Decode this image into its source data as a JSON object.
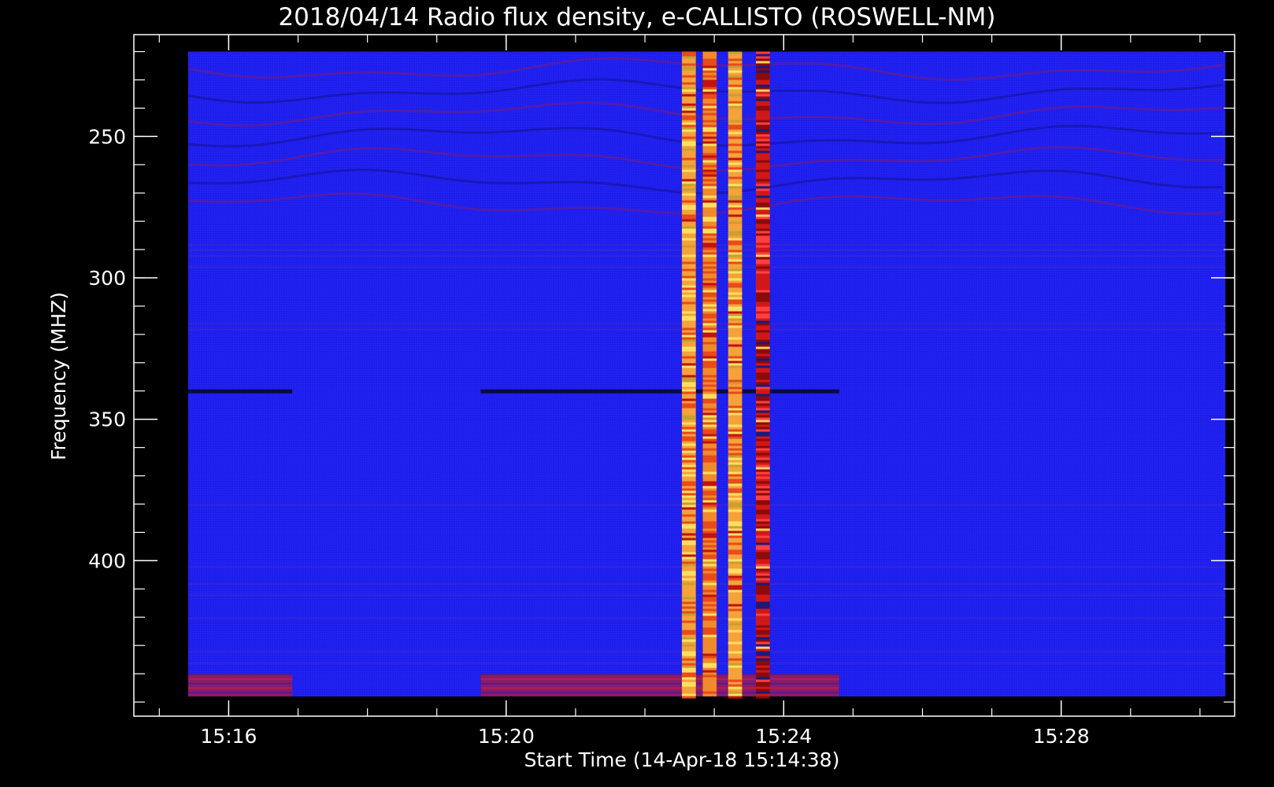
{
  "chart_data": {
    "type": "heatmap",
    "title": "2018/04/14  Radio flux density, e-CALLISTO (ROSWELL-NM)",
    "xlabel": "Start Time (14-Apr-18 15:14:38)",
    "ylabel": "Frequency (MHZ)",
    "x_unit": "UT time",
    "y_unit": "MHz",
    "xlim": [
      "15:14:38",
      "15:30:30"
    ],
    "ylim": [
      214,
      455
    ],
    "y_inverted": true,
    "data_x_range": [
      "15:15:25",
      "15:30:22"
    ],
    "data_y_range": [
      220,
      448
    ],
    "x_ticks": [
      {
        "time": "15:16",
        "label": "15:16"
      },
      {
        "time": "15:20",
        "label": "15:20"
      },
      {
        "time": "15:24",
        "label": "15:24"
      },
      {
        "time": "15:28",
        "label": "15:28"
      }
    ],
    "y_ticks": [
      {
        "value": 250,
        "label": "250"
      },
      {
        "value": 300,
        "label": "300"
      },
      {
        "value": 350,
        "label": "350"
      },
      {
        "value": 400,
        "label": "400"
      }
    ],
    "colors": {
      "background": "#000000",
      "frame": "#ffffff",
      "quiet_level": "#1f1ff2",
      "burst_palette": [
        "#f5a23a",
        "#e84a1a",
        "#ffe060",
        "#c01010",
        "#1a1a7a"
      ]
    },
    "burst_bands": [
      {
        "t_start": "15:22:32",
        "t_end": "15:22:44",
        "intensity": "high",
        "palette": "orange-yellow"
      },
      {
        "t_start": "15:22:50",
        "t_end": "15:23:02",
        "intensity": "high",
        "palette": "orange-red"
      },
      {
        "t_start": "15:23:12",
        "t_end": "15:23:24",
        "intensity": "high",
        "palette": "orange-yellow"
      },
      {
        "t_start": "15:23:36",
        "t_end": "15:23:48",
        "intensity": "high",
        "palette": "red-dark"
      }
    ],
    "dark_lines": [
      {
        "frequency": 340,
        "t_start": "15:15:25",
        "t_end": "15:16:55"
      },
      {
        "frequency": 340,
        "t_start": "15:19:38",
        "t_end": "15:24:48"
      }
    ],
    "bottom_rfi": [
      {
        "f_start": 440,
        "f_end": 448,
        "t_start": "15:15:25",
        "t_end": "15:16:55"
      },
      {
        "f_start": 440,
        "f_end": 448,
        "t_start": "15:19:38",
        "t_end": "15:24:48"
      }
    ]
  }
}
